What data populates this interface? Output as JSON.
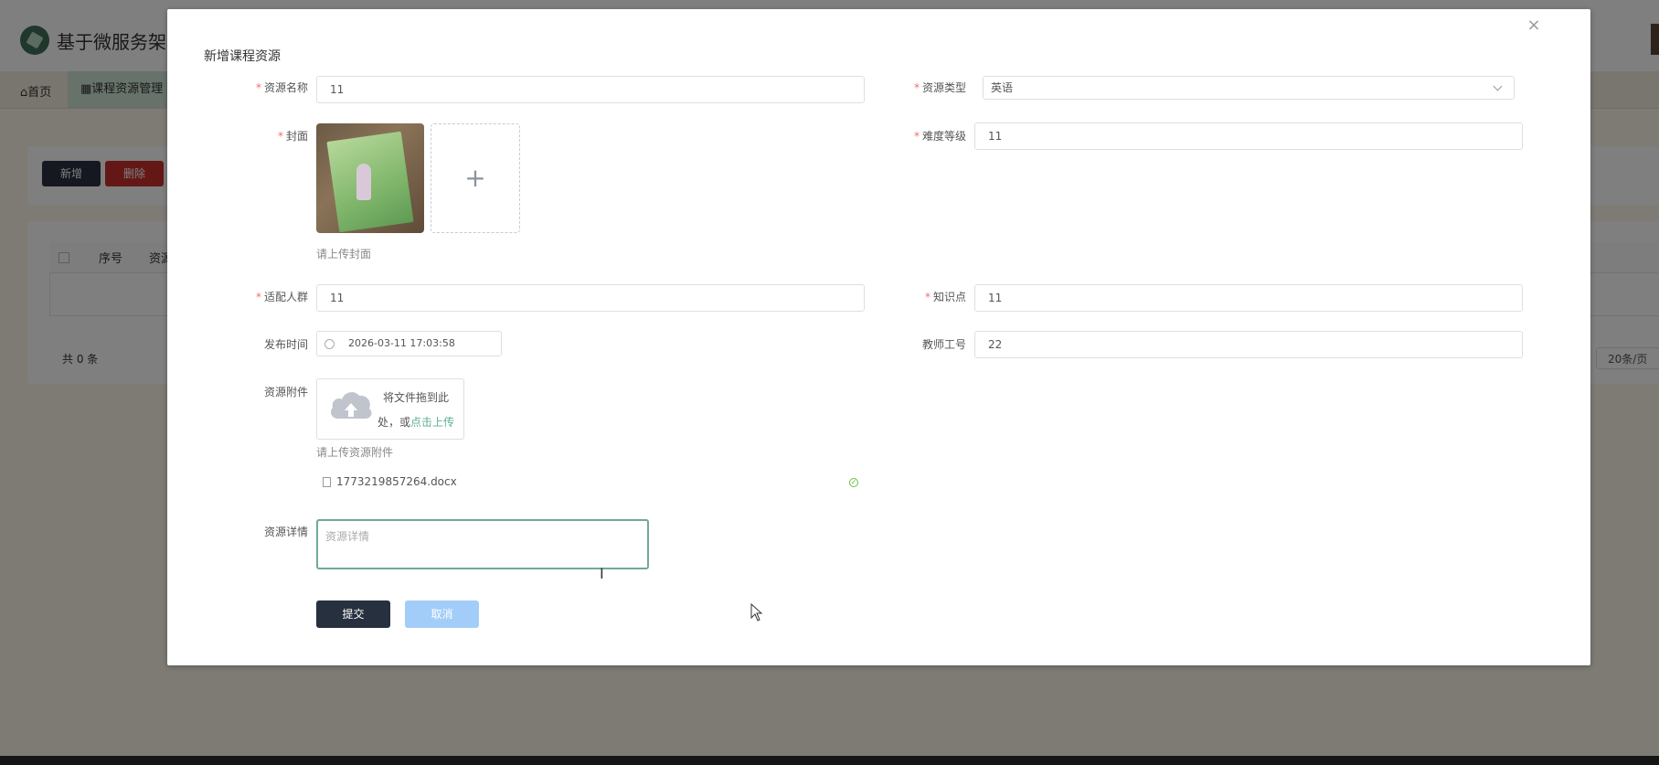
{
  "app": {
    "title": "基于微服务架构",
    "nav": {
      "home": "首页",
      "course_tab": "课程资源管理"
    },
    "toolbar": {
      "add_label": "新增",
      "delete_label": "删除"
    },
    "table": {
      "columns": [
        "序号",
        "资源"
      ]
    },
    "pagination": {
      "total": "共 0 条",
      "page_size": "20条/页"
    }
  },
  "dialog": {
    "title": "新增课程资源",
    "close_icon": "close-icon",
    "fields": {
      "resource_name": {
        "label": "资源名称",
        "value": "11",
        "required": true
      },
      "resource_type": {
        "label": "资源类型",
        "value": "英语",
        "required": true
      },
      "cover": {
        "label": "封面",
        "tip": "请上传封面",
        "required": true
      },
      "difficulty": {
        "label": "难度等级",
        "value": "11",
        "required": true
      },
      "audience": {
        "label": "适配人群",
        "value": "11",
        "required": true
      },
      "knowledge": {
        "label": "知识点",
        "value": "11",
        "required": true
      },
      "publish_time": {
        "label": "发布时间",
        "value": "2026-03-11 17:03:58"
      },
      "teacher_id": {
        "label": "教师工号",
        "value": "22"
      },
      "attachment": {
        "label": "资源附件",
        "drop_text_1": "将文件拖到此",
        "drop_text_2": "处，或",
        "drop_link": "点击上传",
        "tip": "请上传资源附件",
        "file_name": "1773219857264.docx"
      },
      "detail": {
        "label": "资源详情",
        "placeholder": "资源详情"
      }
    },
    "buttons": {
      "submit": "提交",
      "cancel": "取消"
    }
  },
  "colors": {
    "primary_dark": "#27303e",
    "cancel_blue": "#a3cdf9",
    "required_red": "#f56c6c",
    "success_green": "#67c23a",
    "link_green": "#5fae97"
  }
}
